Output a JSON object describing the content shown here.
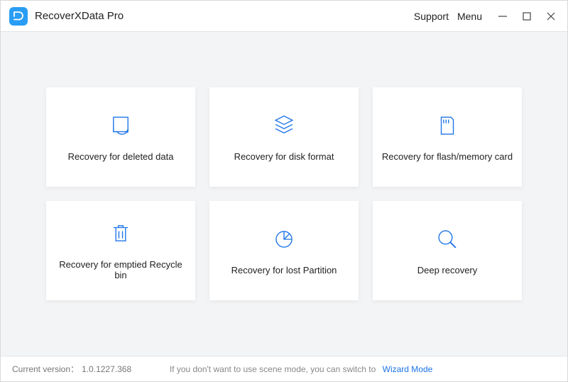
{
  "app": {
    "title": "RecoverXData Pro"
  },
  "titlebar": {
    "support": "Support",
    "menu": "Menu"
  },
  "cards": [
    {
      "label": "Recovery for deleted data"
    },
    {
      "label": "Recovery for disk format"
    },
    {
      "label": "Recovery for flash/memory card"
    },
    {
      "label": "Recovery for emptied Recycle bin"
    },
    {
      "label": "Recovery for lost Partition"
    },
    {
      "label": "Deep recovery"
    }
  ],
  "footer": {
    "version_label": "Current version：",
    "version_value": "1.0.1227.368",
    "mode_hint": "If you don't want to use scene mode, you can switch to",
    "wizard_link": "Wizard Mode"
  },
  "colors": {
    "accent": "#1c74e8",
    "logo_bg": "#2a9df4",
    "bg": "#f3f4f6",
    "card_bg": "#ffffff"
  }
}
